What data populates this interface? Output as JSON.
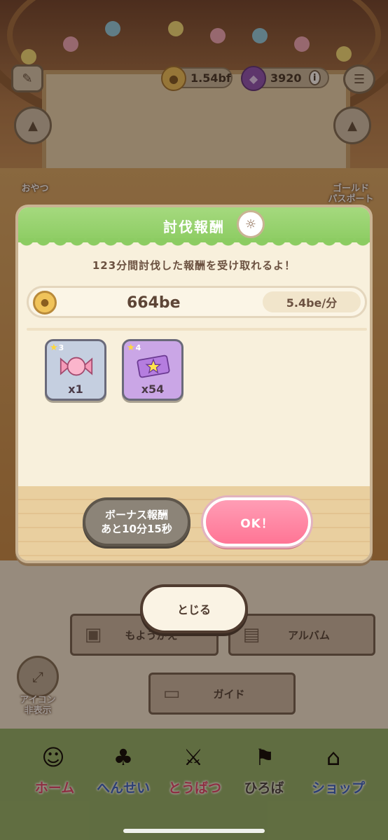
{
  "hud": {
    "gold": "1.54bf",
    "gems": "3920",
    "info_icon": "info-icon",
    "menu_icon": "list-icon",
    "snack_label": "おやつ",
    "pass_label_1": "ゴールド",
    "pass_label_2": "パスポート"
  },
  "dialog": {
    "title": "討伐報酬",
    "message": "123分間討伐した報酬を受け取れるよ！",
    "reward_amount": "664be",
    "rate": "5.4be/分",
    "items": [
      {
        "rarity": "3",
        "qty": "x1",
        "icon": "candy-icon"
      },
      {
        "rarity": "4",
        "qty": "x54",
        "icon": "star-ticket-icon"
      }
    ],
    "bonus_line1": "ボーナス報酬",
    "bonus_line2": "あと10分15秒",
    "ok_label": "OK！"
  },
  "close_label": "とじる",
  "menu": {
    "moyougae": "もようがえ",
    "album": "アルバム",
    "guide": "ガイド"
  },
  "icon_toggle_1": "アイコン",
  "icon_toggle_2": "非表示",
  "tabs": [
    {
      "label": "ホーム",
      "color": "#e0426a"
    },
    {
      "label": "へんせい",
      "color": "#2f5fc7"
    },
    {
      "label": "とうばつ",
      "color": "#e0426a"
    },
    {
      "label": "ひろば",
      "color": "#3f3f3f"
    },
    {
      "label": "ショップ",
      "color": "#2f5fc7"
    }
  ]
}
